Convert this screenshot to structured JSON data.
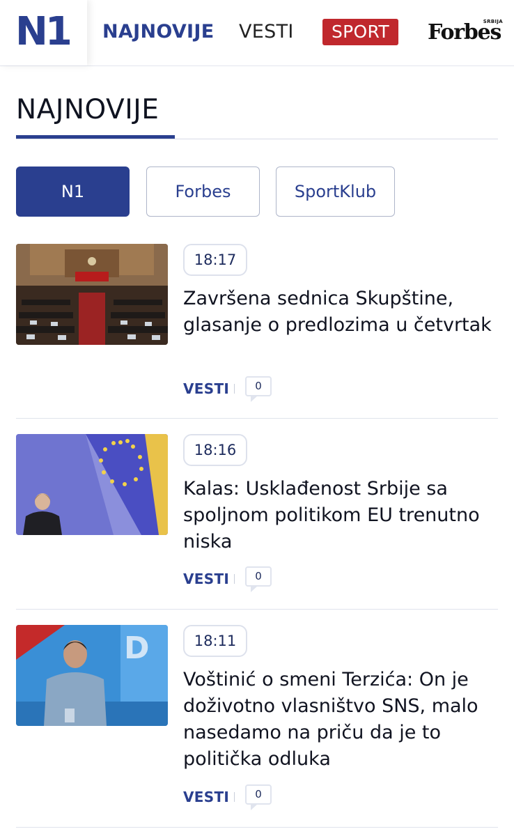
{
  "nav": {
    "logo_text": "N1",
    "najnovije": "NAJNOVIJE",
    "vesti": "VESTI",
    "sport": "SPORT",
    "forbes": "Forbes",
    "forbes_sub": "SRBIJA"
  },
  "page": {
    "title": "NAJNOVIJE"
  },
  "tabs": [
    {
      "label": "N1",
      "active": true
    },
    {
      "label": "Forbes",
      "active": false
    },
    {
      "label": "SportKlub",
      "active": false
    }
  ],
  "articles": [
    {
      "time": "18:17",
      "headline": "Završena sednica Skupštine, glasanje o predlozima u četvrtak",
      "category": "VESTI",
      "comments": "0",
      "image": "parliament-session-photo"
    },
    {
      "time": "18:16",
      "headline": "Kalas: Usklađenost Srbije sa spoljnom politikom EU trenutno niska",
      "category": "VESTI",
      "comments": "0",
      "image": "eu-flag-speaker-photo"
    },
    {
      "time": "18:11",
      "headline": "Voštinić o smeni Terzića: On je doživotno vlasništvo SNS, malo nasedamo na priču da je to politička odluka",
      "category": "VESTI",
      "comments": "0",
      "image": "tv-studio-guest-photo"
    }
  ],
  "colors": {
    "brand_blue": "#2a3f8f",
    "sport_red": "#c0282d"
  }
}
